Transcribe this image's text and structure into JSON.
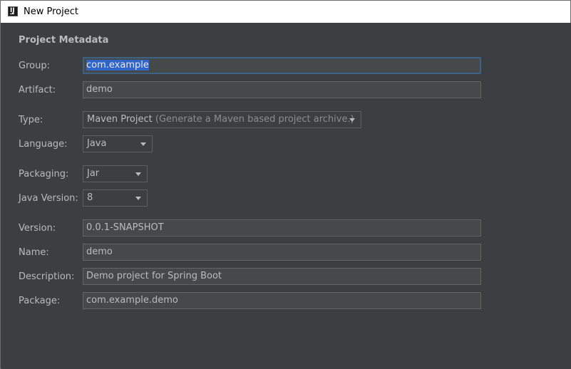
{
  "window": {
    "title": "New Project",
    "icon_glyph": "IJ"
  },
  "section": {
    "title": "Project Metadata"
  },
  "form": {
    "group": {
      "label": "Group:",
      "value": "com.example"
    },
    "artifact": {
      "label": "Artifact:",
      "value": "demo"
    },
    "type": {
      "label": "Type:",
      "value": "Maven Project",
      "hint": "(Generate a Maven based project archive.)"
    },
    "language": {
      "label": "Language:",
      "value": "Java"
    },
    "packaging": {
      "label": "Packaging:",
      "value": "Jar"
    },
    "java_version": {
      "label": "Java Version:",
      "value": "8"
    },
    "version": {
      "label": "Version:",
      "value": "0.0.1-SNAPSHOT"
    },
    "name": {
      "label": "Name:",
      "value": "demo"
    },
    "description": {
      "label": "Description:",
      "value": "Demo project for Spring Boot"
    },
    "package": {
      "label": "Package:",
      "value": "com.example.demo"
    }
  },
  "colors": {
    "background": "#3c3f41",
    "field_background": "#45494a",
    "text": "#bbbbbb",
    "selection": "#2f65ca",
    "focus_border": "#3d6185"
  },
  "icons": {
    "app": "intellij-app-icon",
    "dropdown": "chevron-down-icon"
  }
}
